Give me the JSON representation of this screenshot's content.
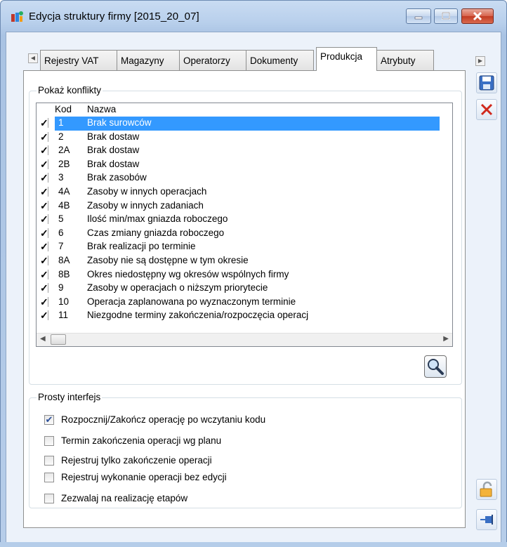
{
  "window": {
    "title": "Edycja struktury firmy [2015_20_07]",
    "accent_color": "#3399ff",
    "close_color": "#c23b22"
  },
  "tabs": [
    {
      "label": "Rejestry VAT",
      "active": false
    },
    {
      "label": "Magazyny",
      "active": false
    },
    {
      "label": "Operatorzy",
      "active": false
    },
    {
      "label": "Dokumenty",
      "active": false
    },
    {
      "label": "Produkcja",
      "active": true
    },
    {
      "label": "Atrybuty",
      "active": false
    }
  ],
  "conflicts": {
    "group_label": "Pokaż konflikty",
    "columns": {
      "code": "Kod",
      "name": "Nazwa"
    },
    "rows": [
      {
        "checked": true,
        "code": "1",
        "name": "Brak surowców",
        "selected": true
      },
      {
        "checked": true,
        "code": "2",
        "name": "Brak dostaw"
      },
      {
        "checked": true,
        "code": "2A",
        "name": "Brak dostaw"
      },
      {
        "checked": true,
        "code": "2B",
        "name": "Brak dostaw"
      },
      {
        "checked": true,
        "code": "3",
        "name": "Brak zasobów"
      },
      {
        "checked": true,
        "code": "4A",
        "name": "Zasoby w innych operacjach"
      },
      {
        "checked": true,
        "code": "4B",
        "name": "Zasoby w innych zadaniach"
      },
      {
        "checked": true,
        "code": "5",
        "name": "Ilość min/max gniazda roboczego"
      },
      {
        "checked": true,
        "code": "6",
        "name": "Czas zmiany gniazda roboczego"
      },
      {
        "checked": true,
        "code": "7",
        "name": "Brak realizacji po terminie"
      },
      {
        "checked": true,
        "code": "8A",
        "name": "Zasoby nie są dostępne w tym okresie"
      },
      {
        "checked": true,
        "code": "8B",
        "name": "Okres niedostępny wg okresów wspólnych firmy"
      },
      {
        "checked": true,
        "code": "9",
        "name": "Zasoby w operacjach o niższym priorytecie"
      },
      {
        "checked": true,
        "code": "10",
        "name": "Operacja zaplanowana po wyznaczonym terminie"
      },
      {
        "checked": true,
        "code": "11",
        "name": "Niezgodne terminy zakończenia/rozpoczęcia operacj"
      }
    ],
    "search_icon": "magnifier-icon"
  },
  "simple_interface": {
    "group_label": "Prosty interfejs",
    "options": [
      {
        "label": "Rozpocznij/Zakończ operację po wczytaniu kodu",
        "checked": true
      },
      {
        "label": "Termin zakończenia operacji wg planu",
        "checked": false
      },
      {
        "label": "Rejestruj tylko zakończenie operacji",
        "checked": false
      },
      {
        "label": "Rejestruj wykonanie operacji bez edycji",
        "checked": false
      },
      {
        "label": "Zezwalaj na realizację etapów",
        "checked": false
      }
    ]
  },
  "side_buttons": [
    "save-icon",
    "cancel-icon",
    "lock-icon",
    "pin-icon"
  ],
  "glyphs": {
    "check": "✔",
    "checkmark": "✓",
    "tab_left": "◀",
    "tab_right": "▶",
    "scroll_left": "◀",
    "scroll_right": "▶"
  }
}
